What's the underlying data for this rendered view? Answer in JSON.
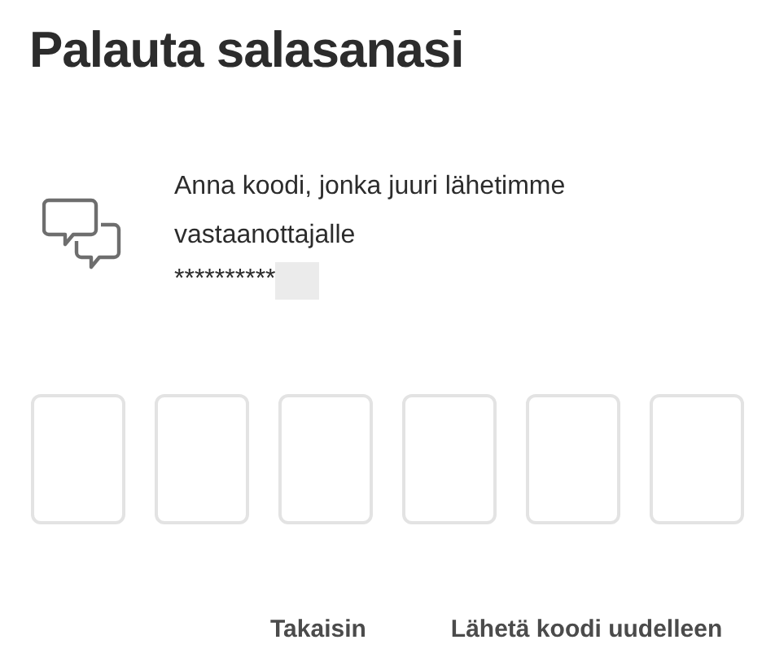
{
  "title": "Palauta salasanasi",
  "message": "Anna koodi, jonka juuri lähetimme vastaanottajalle",
  "masked_recipient": "**********",
  "code_fields": [
    {
      "filled": false
    },
    {
      "filled": false
    },
    {
      "filled": false
    },
    {
      "filled": false
    },
    {
      "filled": false
    },
    {
      "filled": false
    }
  ],
  "buttons": [
    {
      "label": "Takaisin"
    },
    {
      "label": "Lähetä koodi uudelleen"
    }
  ]
}
